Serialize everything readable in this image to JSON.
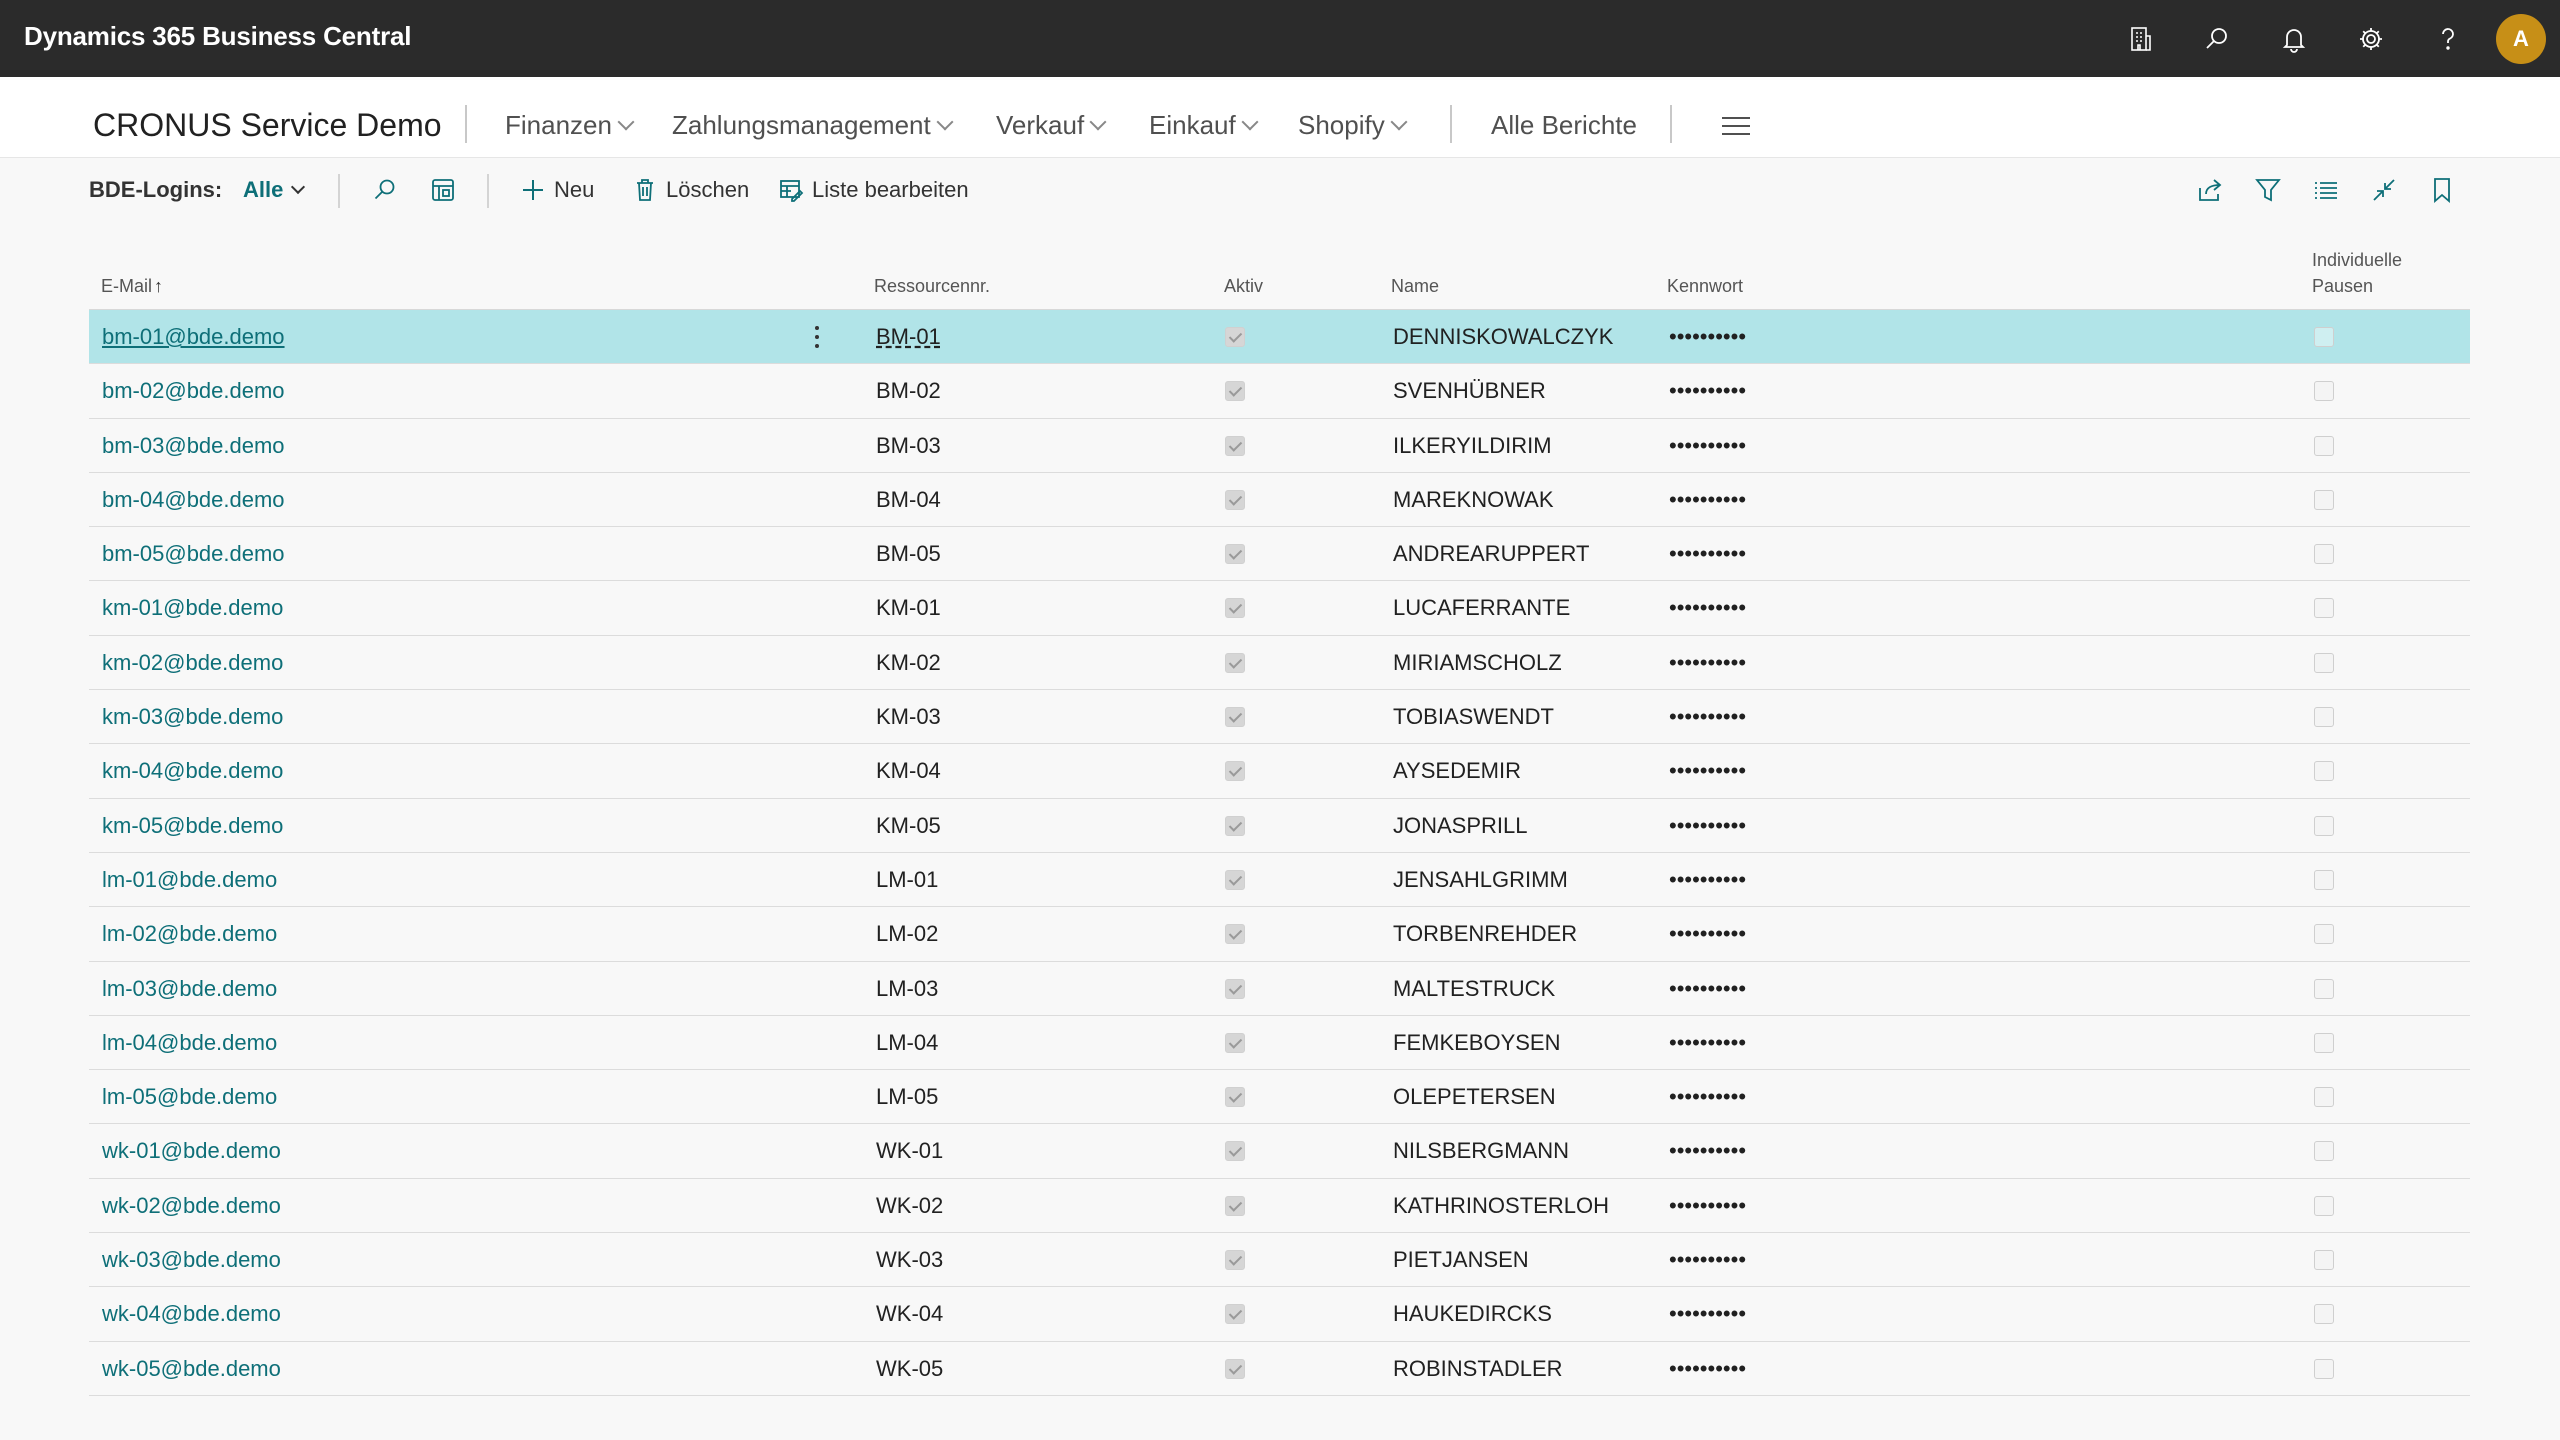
{
  "app": {
    "title": "Dynamics 365 Business Central",
    "avatar_initial": "A"
  },
  "appbar_icons": [
    "building-icon",
    "search-icon",
    "bell-icon",
    "gear-icon",
    "help-icon"
  ],
  "nav": {
    "company": "CRONUS Service Demo",
    "menus": [
      "Finanzen",
      "Zahlungsmanagement",
      "Verkauf",
      "Einkauf",
      "Shopify"
    ],
    "all_reports": "Alle Berichte"
  },
  "actionbar": {
    "label": "BDE-Logins:",
    "filter": "Alle",
    "new": "Neu",
    "delete": "Löschen",
    "edit_list": "Liste bearbeiten"
  },
  "columns": {
    "email": "E-Mail",
    "resource": "Ressourcennr.",
    "active": "Aktiv",
    "name": "Name",
    "password": "Kennwort",
    "pauses_line1": "Individuelle",
    "pauses_line2": "Pausen"
  },
  "rows": [
    {
      "email": "bm-01@bde.demo",
      "resource": "BM-01",
      "name": "DENNISKOWALCZYK",
      "password": "••••••••••",
      "active": true,
      "pauses": false
    },
    {
      "email": "bm-02@bde.demo",
      "resource": "BM-02",
      "name": "SVENHÜBNER",
      "password": "••••••••••",
      "active": true,
      "pauses": false
    },
    {
      "email": "bm-03@bde.demo",
      "resource": "BM-03",
      "name": "ILKERYILDIRIM",
      "password": "••••••••••",
      "active": true,
      "pauses": false
    },
    {
      "email": "bm-04@bde.demo",
      "resource": "BM-04",
      "name": "MAREKNOWAK",
      "password": "••••••••••",
      "active": true,
      "pauses": false
    },
    {
      "email": "bm-05@bde.demo",
      "resource": "BM-05",
      "name": "ANDREARUPPERT",
      "password": "••••••••••",
      "active": true,
      "pauses": false
    },
    {
      "email": "km-01@bde.demo",
      "resource": "KM-01",
      "name": "LUCAFERRANTE",
      "password": "••••••••••",
      "active": true,
      "pauses": false
    },
    {
      "email": "km-02@bde.demo",
      "resource": "KM-02",
      "name": "MIRIAMSCHOLZ",
      "password": "••••••••••",
      "active": true,
      "pauses": false
    },
    {
      "email": "km-03@bde.demo",
      "resource": "KM-03",
      "name": "TOBIASWENDT",
      "password": "••••••••••",
      "active": true,
      "pauses": false
    },
    {
      "email": "km-04@bde.demo",
      "resource": "KM-04",
      "name": "AYSEDEMIR",
      "password": "••••••••••",
      "active": true,
      "pauses": false
    },
    {
      "email": "km-05@bde.demo",
      "resource": "KM-05",
      "name": "JONASPRILL",
      "password": "••••••••••",
      "active": true,
      "pauses": false
    },
    {
      "email": "lm-01@bde.demo",
      "resource": "LM-01",
      "name": "JENSAHLGRIMM",
      "password": "••••••••••",
      "active": true,
      "pauses": false
    },
    {
      "email": "lm-02@bde.demo",
      "resource": "LM-02",
      "name": "TORBENREHDER",
      "password": "••••••••••",
      "active": true,
      "pauses": false
    },
    {
      "email": "lm-03@bde.demo",
      "resource": "LM-03",
      "name": "MALTESTRUCK",
      "password": "••••••••••",
      "active": true,
      "pauses": false
    },
    {
      "email": "lm-04@bde.demo",
      "resource": "LM-04",
      "name": "FEMKEBOYSEN",
      "password": "••••••••••",
      "active": true,
      "pauses": false
    },
    {
      "email": "lm-05@bde.demo",
      "resource": "LM-05",
      "name": "OLEPETERSEN",
      "password": "••••••••••",
      "active": true,
      "pauses": false
    },
    {
      "email": "wk-01@bde.demo",
      "resource": "WK-01",
      "name": "NILSBERGMANN",
      "password": "••••••••••",
      "active": true,
      "pauses": false
    },
    {
      "email": "wk-02@bde.demo",
      "resource": "WK-02",
      "name": "KATHRINOSTERLOH",
      "password": "••••••••••",
      "active": true,
      "pauses": false
    },
    {
      "email": "wk-03@bde.demo",
      "resource": "WK-03",
      "name": "PIETJANSEN",
      "password": "••••••••••",
      "active": true,
      "pauses": false
    },
    {
      "email": "wk-04@bde.demo",
      "resource": "WK-04",
      "name": "HAUKEDIRCKS",
      "password": "••••••••••",
      "active": true,
      "pauses": false
    },
    {
      "email": "wk-05@bde.demo",
      "resource": "WK-05",
      "name": "ROBINSTADLER",
      "password": "••••••••••",
      "active": true,
      "pauses": false
    }
  ],
  "colors": {
    "appbar": "#2b2b2b",
    "link": "#0e6f78",
    "selected_row": "#b1e4e8",
    "avatar": "#c78f17"
  }
}
